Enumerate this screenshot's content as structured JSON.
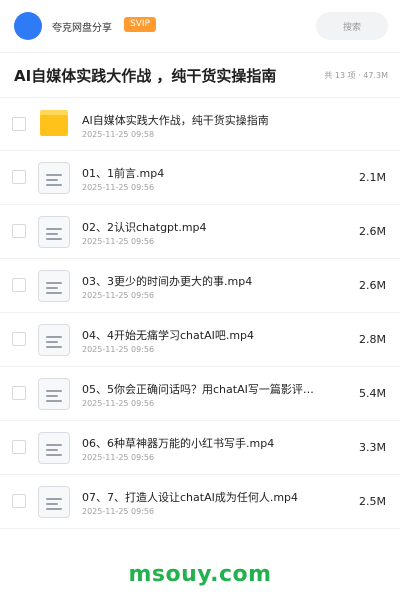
{
  "header": {
    "share_name": "夸克网盘分享",
    "badge": "SVIP",
    "search_placeholder": "搜索"
  },
  "folder": {
    "title": "AI自媒体实践大作战 ，纯干货实操指南",
    "meta": "共 13 项 · 47.3M"
  },
  "items": [
    {
      "type": "folder",
      "name": "AI自媒体实践大作战，纯干货实操指南",
      "date": "2025-11-25 09:58",
      "size": ""
    },
    {
      "type": "file",
      "name": "01、1前言.mp4",
      "date": "2025-11-25 09:56",
      "size": "2.1M"
    },
    {
      "type": "file",
      "name": "02、2认识chatgpt.mp4",
      "date": "2025-11-25 09:56",
      "size": "2.6M"
    },
    {
      "type": "file",
      "name": "03、3更少的时间办更大的事.mp4",
      "date": "2025-11-25 09:56",
      "size": "2.6M"
    },
    {
      "type": "file",
      "name": "04、4开始无痛学习chatAI吧.mp4",
      "date": "2025-11-25 09:56",
      "size": "2.8M"
    },
    {
      "type": "file",
      "name": "05、5你会正确问话吗？用chatAI写一篇影评.…",
      "date": "2025-11-25 09:56",
      "size": "5.4M"
    },
    {
      "type": "file",
      "name": "06、6种草神器万能的小红书写手.mp4",
      "date": "2025-11-25 09:56",
      "size": "3.3M"
    },
    {
      "type": "file",
      "name": "07、7、打造人设让chatAI成为任何人.mp4",
      "date": "2025-11-25 09:56",
      "size": "2.5M"
    }
  ],
  "watermark": "msouy.com",
  "colors": {
    "avatar": "#2f7bf5",
    "badge": "#ff9b2f",
    "folder": "#ffc21a",
    "watermark": "#22b14c"
  }
}
